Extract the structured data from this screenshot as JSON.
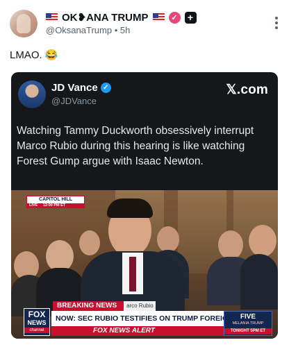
{
  "post": {
    "display_name": "OK❥ANA TRUMP",
    "handle": "@OksanaTrump",
    "separator": "•",
    "time": "5h",
    "text": "LMAO. 😂"
  },
  "quoted": {
    "name": "JD Vance",
    "handle": "@JDVance",
    "brand": "𝕏.com",
    "text": "Watching Tammy Duckworth obsessively interrupt Marco Rubio during this hearing is like watching Forest Gump argue with Isaac Newton."
  },
  "broadcast": {
    "location": "CAPITOL HILL",
    "live": "LIVE",
    "time": "12:00 PM ET",
    "breaking": "BREAKING NEWS",
    "speaker_tag": "arco Rubio",
    "headline": "NOW: SEC RUBIO TESTIFIES ON TRUMP FOREIGN POLICY",
    "alert": "FOX NEWS ALERT",
    "network_line1": "FOX",
    "network_line2": "NEWS",
    "network_line3": "channel",
    "promo_title": "FIVE",
    "promo_sub": "MELANIA TRUMP",
    "promo_time": "TONIGHT 5PM ET"
  },
  "colors": {
    "fox_red": "#c8102e",
    "fox_navy": "#12264f",
    "verified_blue": "#1d9bf0",
    "verified_pink": "#e8467c"
  },
  "icons": [
    "us-flag-icon",
    "verified-badge-icon",
    "subscriber-plus-icon",
    "more-options-icon",
    "blue-check-icon"
  ]
}
